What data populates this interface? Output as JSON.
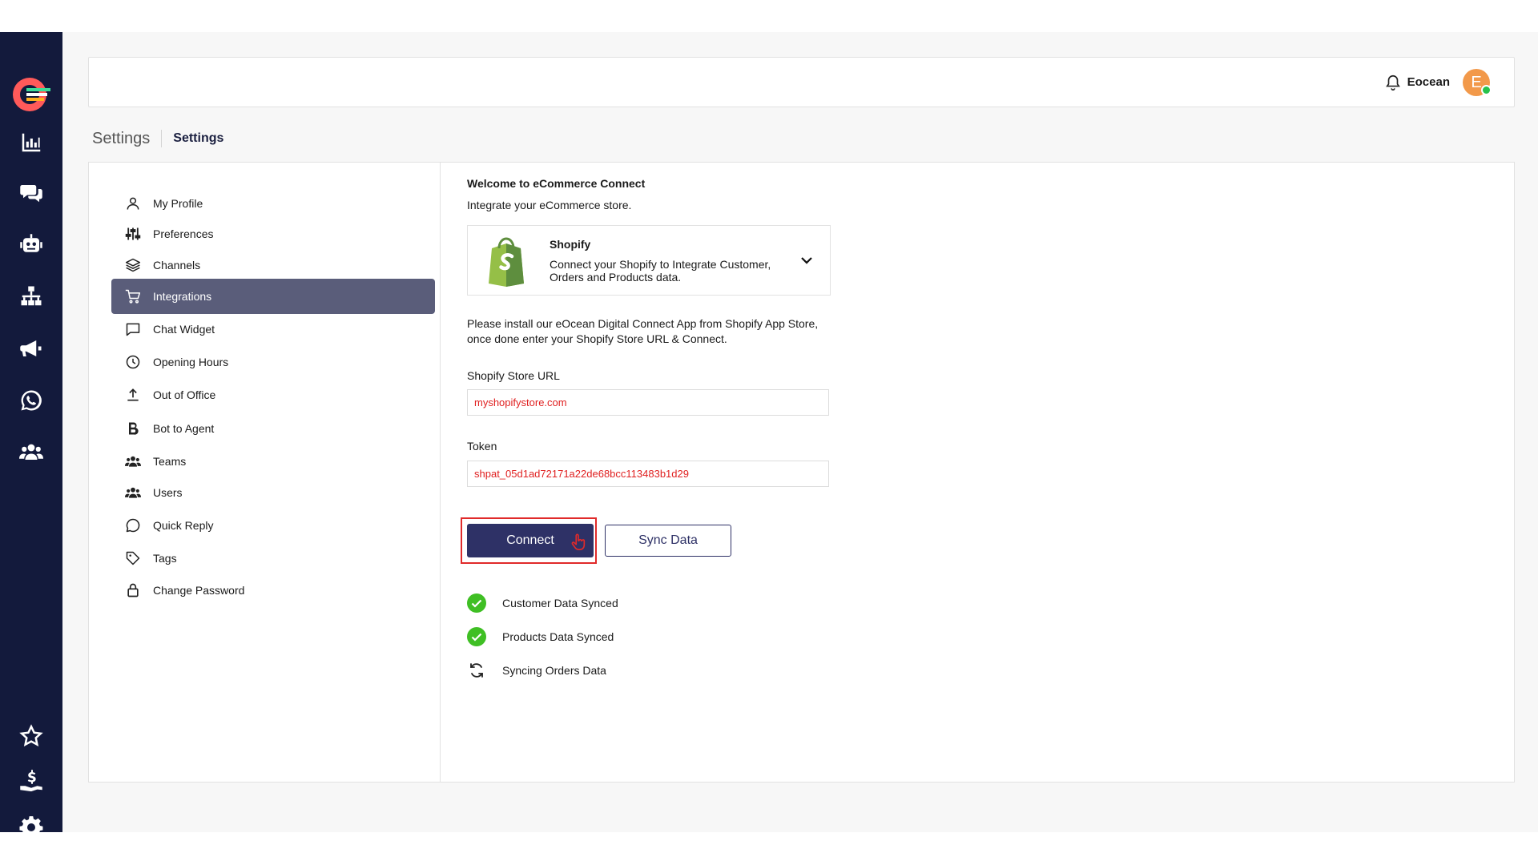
{
  "user": {
    "name": "Eocean",
    "initial": "E",
    "status_color": "#27c24c",
    "avatar_color": "#f2994a"
  },
  "breadcrumb": {
    "section": "Settings",
    "page": "Settings"
  },
  "rail": {
    "top_icons": [
      "chart-bar-icon",
      "chat-bubbles-icon",
      "robot-icon",
      "network-icon",
      "megaphone-icon",
      "whatsapp-icon",
      "users-group-icon"
    ],
    "bottom_icons": [
      "star-icon",
      "dollar-hand-icon",
      "gear-icon"
    ]
  },
  "settings_menu": {
    "items": [
      {
        "label": "My Profile",
        "icon": "user-icon"
      },
      {
        "label": "Preferences",
        "icon": "sliders-icon"
      },
      {
        "label": "Channels",
        "icon": "layers-icon"
      },
      {
        "label": "Integrations",
        "icon": "cart-icon",
        "active": true
      },
      {
        "label": "Chat Widget",
        "icon": "message-square-icon"
      },
      {
        "label": "Opening Hours",
        "icon": "clock-icon"
      },
      {
        "label": "Out of Office",
        "icon": "upload-icon"
      },
      {
        "label": "Bot to Agent",
        "icon": "bold-b-icon"
      },
      {
        "label": "Teams",
        "icon": "team-icon"
      },
      {
        "label": "Users",
        "icon": "users-icon"
      },
      {
        "label": "Quick Reply",
        "icon": "chat-circle-icon"
      },
      {
        "label": "Tags",
        "icon": "tag-icon"
      },
      {
        "label": "Change Password",
        "icon": "lock-icon"
      }
    ]
  },
  "integration": {
    "welcome_title": "Welcome to eCommerce Connect",
    "subtitle": "Integrate your eCommerce store.",
    "shopify": {
      "name": "Shopify",
      "description": "Connect your Shopify to Integrate Customer, Orders and Products data.",
      "brand_color": "#95bf47"
    },
    "install_note": "Please install our eOcean Digital Connect App from Shopify App Store, once done enter your Shopify Store URL & Connect.",
    "url_label": "Shopify Store URL",
    "url_value": "myshopifystore.com",
    "token_label": "Token",
    "token_value": "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",
    "connect_label": "Connect",
    "sync_label": "Sync Data",
    "statuses": [
      {
        "text": "Customer Data Synced",
        "state": "done"
      },
      {
        "text": "Products Data Synced",
        "state": "done"
      },
      {
        "text": "Syncing Orders Data",
        "state": "syncing"
      }
    ]
  },
  "colors": {
    "sidebar": "#131a3c",
    "primary": "#2e3166",
    "active_menu": "#5a5d7a",
    "success": "#3fbf24",
    "error": "#e02020"
  }
}
